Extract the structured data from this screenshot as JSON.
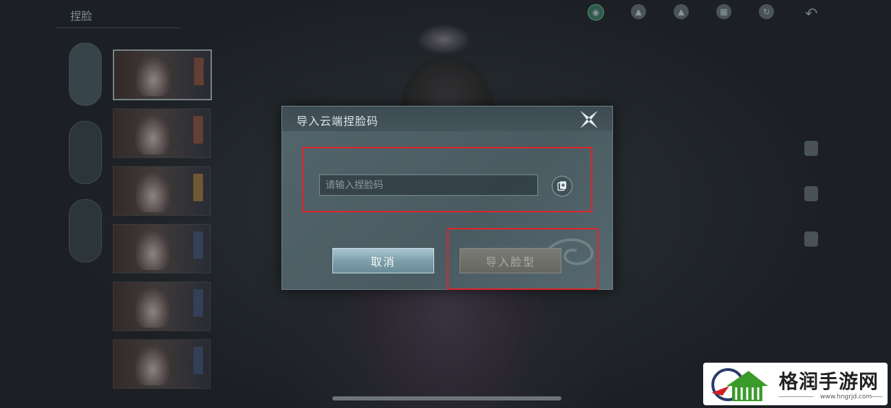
{
  "background": {
    "title": "捏脸",
    "top_icons": [
      {
        "name": "face-icon",
        "active": true
      },
      {
        "name": "cloud-upload-icon",
        "active": false
      },
      {
        "name": "cloud-download-icon",
        "active": false
      },
      {
        "name": "gallery-icon",
        "active": false
      },
      {
        "name": "reset-icon",
        "active": false
      }
    ],
    "back_icon": "back-arrow-icon",
    "left_tab_count": 3,
    "character_card_count": 6
  },
  "dialog": {
    "title": "导入云端捏脸码",
    "close_icon": "close-x-icon",
    "input": {
      "value": "",
      "placeholder": "请输入捏脸码"
    },
    "paste_icon": "paste-icon",
    "cancel_label": "取消",
    "import_label": "导入脸型",
    "import_enabled": false
  },
  "highlight_color": "#e0252a",
  "watermark": {
    "name": "格润手游网",
    "url": "www.hngrjd.com"
  }
}
